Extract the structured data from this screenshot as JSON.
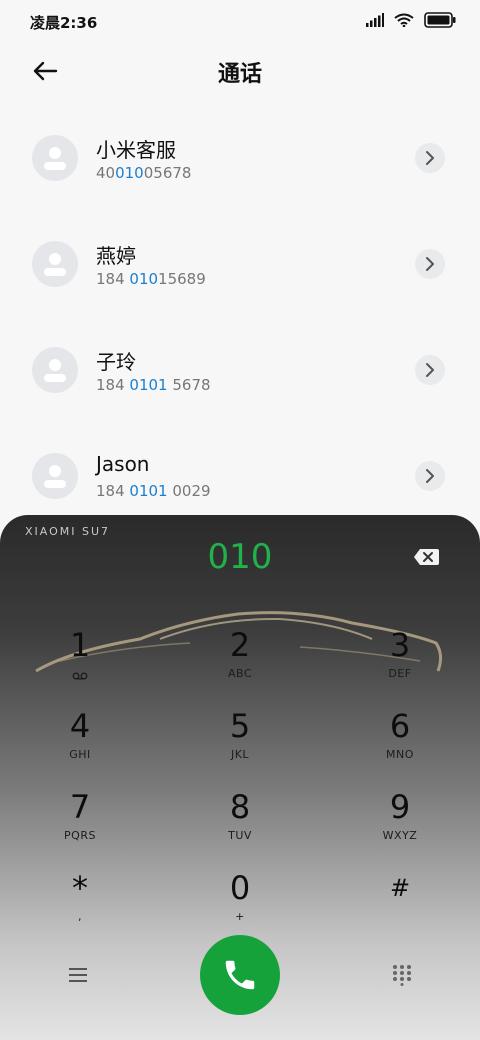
{
  "status_bar": {
    "time": "凌晨2:36",
    "icons": [
      "signal-icon",
      "wifi-icon",
      "battery-icon"
    ]
  },
  "header": {
    "title": "通话",
    "back_icon": "back-arrow-icon"
  },
  "contacts": [
    {
      "name": "小米客服",
      "number_parts": [
        "40",
        "010",
        "05678"
      ]
    },
    {
      "name": "燕婷",
      "number_parts": [
        "184 ",
        "010",
        "15689"
      ]
    },
    {
      "name": "子玲",
      "number_parts": [
        "184 ",
        "0101",
        " 5678"
      ]
    },
    {
      "name": "Jason",
      "number_parts": [
        "184 ",
        "0101",
        " 0029"
      ]
    }
  ],
  "dialer": {
    "brand": "XIAOMI SU7",
    "input_value": "010",
    "input_color": "#22b24c",
    "keys": [
      {
        "digit": "1",
        "letters": ""
      },
      {
        "digit": "2",
        "letters": "ABC"
      },
      {
        "digit": "3",
        "letters": "DEF"
      },
      {
        "digit": "4",
        "letters": "GHI"
      },
      {
        "digit": "5",
        "letters": "JKL"
      },
      {
        "digit": "6",
        "letters": "MNO"
      },
      {
        "digit": "7",
        "letters": "PQRS"
      },
      {
        "digit": "8",
        "letters": "TUV"
      },
      {
        "digit": "9",
        "letters": "WXYZ"
      },
      {
        "digit": "*",
        "letters": ","
      },
      {
        "digit": "0",
        "letters": "+"
      },
      {
        "digit": "#",
        "letters": ""
      }
    ],
    "call_button_color": "#15a23a"
  },
  "colors": {
    "highlight": "#1a7fd0",
    "call_green": "#15a23a"
  }
}
